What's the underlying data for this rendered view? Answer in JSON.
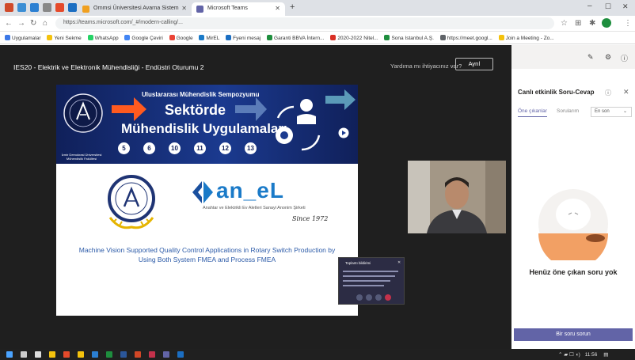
{
  "browser": {
    "tabs": [
      {
        "label": "Ornmsi Üniversitesi Avarna Sistem"
      },
      {
        "label": "Microsoft Teams"
      }
    ],
    "url": "https://teams.microsoft.com/_#/modern-calling/...",
    "bookmarks": [
      "Uygulamalar",
      "Yeni Sekme",
      "WhatsApp",
      "Google Çeviri",
      "Google",
      "MirEL",
      "Fyeni mesaj",
      "Garanti BBVA İntern...",
      "2020-2022 Nitel...",
      "Sona Istanbul A.Ş.",
      "https://meet.googl...",
      "Join a Meeting - Zo..."
    ]
  },
  "meeting": {
    "title": "IES20 - Elektrik ve Elektronik Mühendisliği - Endüstri Oturumu 2",
    "help_link": "Yardıma mı ihtiyacınız var?",
    "leave_label": "Ayrıl"
  },
  "slide": {
    "banner_subtitle": "Uluslararası Mühendislik Sempozyumu",
    "banner_title_1": "Sektörde",
    "banner_title_2": "Mühendislik Uygulamaları",
    "numbers": [
      "5",
      "6",
      "10",
      "11",
      "12",
      "13"
    ],
    "university_caption": "İzmir Demokrasi Üniversitesi Mühendislik Fakültesi",
    "company_logo": "an_eL",
    "company_tagline": "Anahtar ve Elektrikli Ev Aletleri Sanayi Anonim Şirketi",
    "since": "Since 1972",
    "paper_title": "Machine Vision Supported Quality Control Applications in Rotary Switch Production by Using Both System FMEA and Process FMEA"
  },
  "popup": {
    "title": "Toplantı bildirimi"
  },
  "panel": {
    "title": "Canlı etkinlik Soru-Cevap",
    "tab_featured": "Öne çıkanlar",
    "tab_mine": "Sorularım",
    "sort_value": "En son",
    "empty_text": "Henüz öne çıkan soru yok",
    "ask_button": "Bir soru sorun"
  },
  "taskbar": {
    "time": "11:56"
  }
}
